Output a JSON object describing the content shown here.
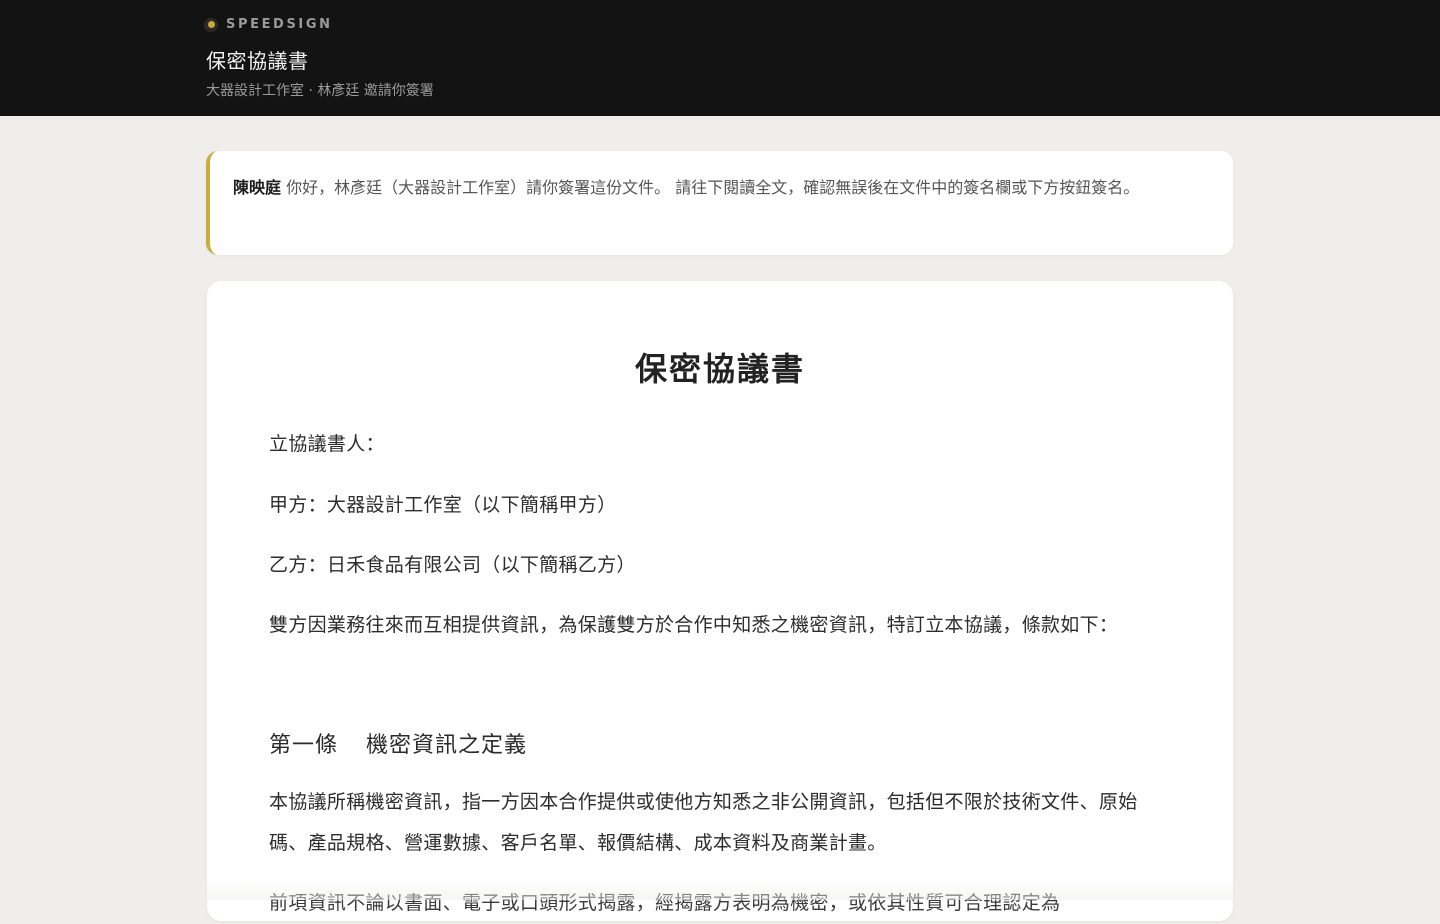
{
  "header": {
    "brand": "SPEEDSIGN",
    "title": "保密協議書",
    "subtitle": "大器設計工作室 · 林彥廷 邀請你簽署"
  },
  "notice": {
    "recipient_name": "陳映庭",
    "message": " 你好，林彥廷（大器設計工作室）請你簽署這份文件。 請往下閱讀全文，確認無誤後在文件中的簽名欄或下方按鈕簽名。"
  },
  "document": {
    "heading": "保密協議書",
    "parties_label": "立協議書人：",
    "party_a": "甲方：大器設計工作室（以下簡稱甲方）",
    "party_b": "乙方：日禾食品有限公司（以下簡稱乙方）",
    "intro": "雙方因業務往來而互相提供資訊，為保護雙方於合作中知悉之機密資訊，特訂立本協議，條款如下：",
    "section1_number": "第一條",
    "section1_title": "機密資訊之定義",
    "section1_body": "本協議所稱機密資訊，指一方因本合作提供或使他方知悉之非公開資訊，包括但不限於技術文件、原始碼、產品規格、營運數據、客戶名單、報價結構、成本資料及商業計畫。",
    "section1_body2": "前項資訊不論以書面、電子或口頭形式揭露，經揭露方表明為機密，或依其性質可合理認定為"
  },
  "colors": {
    "header_bg": "#131313",
    "page_bg": "#efeeea",
    "accent_gold": "#c9ad3f"
  }
}
